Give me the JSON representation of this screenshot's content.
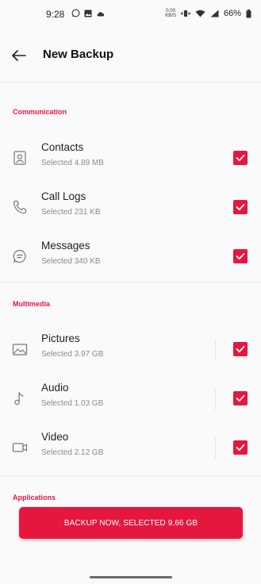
{
  "status": {
    "time": "9:28",
    "netspeed_top": "0.00",
    "netspeed_bottom": "KB/S",
    "battery": "66%"
  },
  "header": {
    "title": "New Backup"
  },
  "sections": {
    "communication": "Communication",
    "multimedia": "Multimedia",
    "applications": "Applications"
  },
  "items": [
    {
      "label": "Contacts",
      "sub": "Selected  4.89 MB",
      "icon": "contacts-icon",
      "checked": true
    },
    {
      "label": "Call Logs",
      "sub": "Selected  231 KB",
      "icon": "phone-icon",
      "checked": true
    },
    {
      "label": "Messages",
      "sub": "Selected  340 KB",
      "icon": "message-icon",
      "checked": true
    },
    {
      "label": "Pictures",
      "sub": "Selected  3.97 GB",
      "icon": "image-icon",
      "checked": true
    },
    {
      "label": "Audio",
      "sub": "Selected  1.03 GB",
      "icon": "music-note-icon",
      "checked": true
    },
    {
      "label": "Video",
      "sub": "Selected  2.12 GB",
      "icon": "video-icon",
      "checked": true
    }
  ],
  "cta": {
    "label": "BACKUP NOW, SELECTED 9.66 GB"
  },
  "colors": {
    "accent": "#e5173f"
  }
}
